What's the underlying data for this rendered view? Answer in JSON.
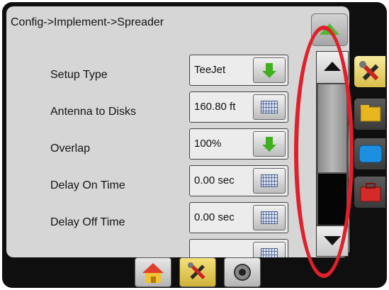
{
  "header": {
    "breadcrumb": "Config->Implement->Spreader"
  },
  "settings": [
    {
      "label": "Setup Type",
      "value": "TeeJet",
      "control": "green-down-arrow-icon"
    },
    {
      "label": "Antenna to Disks",
      "value": "160.80 ft",
      "control": "keyboard-icon"
    },
    {
      "label": "Overlap",
      "value": "100%",
      "control": "green-down-arrow-icon"
    },
    {
      "label": "Delay On Time",
      "value": "0.00 sec",
      "control": "keyboard-icon"
    },
    {
      "label": "Delay Off Time",
      "value": "0.00 sec",
      "control": "keyboard-icon"
    }
  ],
  "scrollbar": {
    "thumb_position": 0.35
  },
  "side_tabs": [
    "tools-icon",
    "folder-icon",
    "display-icon",
    "toolbox-icon"
  ],
  "bottom_tabs": [
    "home-icon",
    "tools-icon",
    "gps-icon"
  ],
  "colors": {
    "accent_green": "#3fae1f",
    "annotation_red": "#e0202a",
    "panel": "#d6d6d6"
  }
}
